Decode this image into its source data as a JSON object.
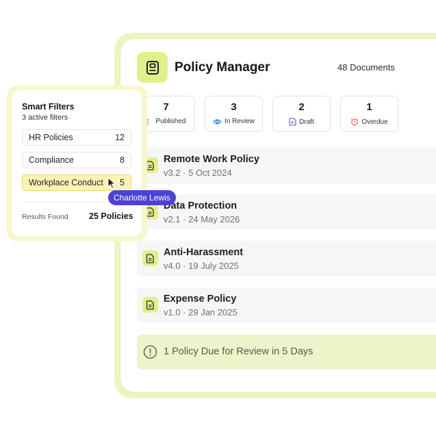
{
  "app": {
    "title": "Policy Manager",
    "document_count": "48 Documents",
    "accent_color": "#e2f08c"
  },
  "stats": [
    {
      "value": "7",
      "label": "Published",
      "icon": "list-icon"
    },
    {
      "value": "3",
      "label": "In Review",
      "icon": "eye-icon"
    },
    {
      "value": "2",
      "label": "Draft",
      "icon": "draft-doc-icon"
    },
    {
      "value": "1",
      "label": "Overdue",
      "icon": "alarm-clock-icon"
    }
  ],
  "policies": [
    {
      "name": "Remote Work Policy",
      "meta": "v3.2 · 5 Oct 2024"
    },
    {
      "name": "Data Protection",
      "meta": "v2.1 · 24 May 2026"
    },
    {
      "name": "Anti-Harassment",
      "meta": "v4.0 · 19 July 2025"
    },
    {
      "name": "Expense Policy",
      "meta": "v1.0 · 29 Jan 2025"
    }
  ],
  "review_banner": {
    "text": "1 Policy Due for Review in 5 Days",
    "icon": "alert-circle-icon"
  },
  "filters": {
    "title": "Smart Filters",
    "subtitle": "3 active filters",
    "items": [
      {
        "label": "HR Policies",
        "count": "12",
        "active": false
      },
      {
        "label": "Compliance",
        "count": "8",
        "active": false
      },
      {
        "label": "Workplace Conduct",
        "count": "5",
        "active": true
      }
    ],
    "results_label": "Results Found",
    "results_value": "25 Policies"
  },
  "collaborator": {
    "name": "Charlotte Lewis",
    "color": "#4a43d6"
  }
}
